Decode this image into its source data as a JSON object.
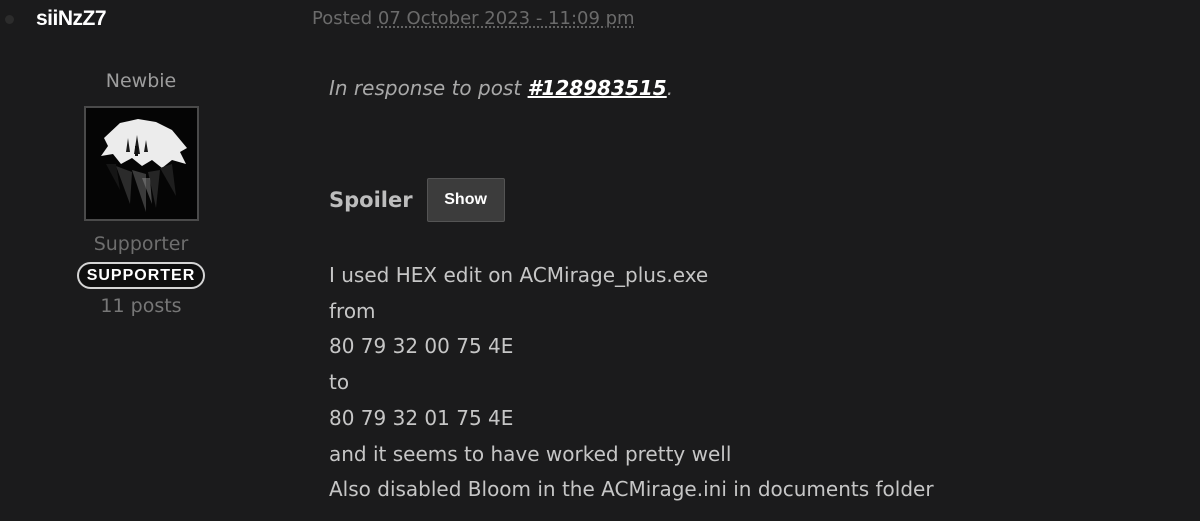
{
  "author": {
    "username": "siiNzZ7",
    "rank_title": "Newbie",
    "group_title": "Supporter",
    "badge_label": "SUPPORTER",
    "post_count": "11 posts"
  },
  "post": {
    "posted_prefix": "Posted",
    "posted_date": "07 October 2023 - 11:09 pm",
    "quote_prefix": "In response to post",
    "quote_link": "#128983515",
    "quote_suffix": ".",
    "spoiler_label": "Spoiler",
    "spoiler_button": "Show",
    "lines": [
      "I used HEX edit on ACMirage_plus.exe",
      "from",
      "80 79 32 00 75 4E",
      "to",
      "80 79 32 01 75 4E",
      "and it seems to have worked pretty well",
      "Also disabled Bloom in the ACMirage.ini in documents folder"
    ]
  },
  "icons": {
    "avatar": "wolf-medallion-avatar",
    "status": "status-dot-icon"
  },
  "colors": {
    "background": "#1b1b1c",
    "username": "#ffffff",
    "body_text": "#c6c6c6",
    "meta_text": "#6b6b6b"
  }
}
